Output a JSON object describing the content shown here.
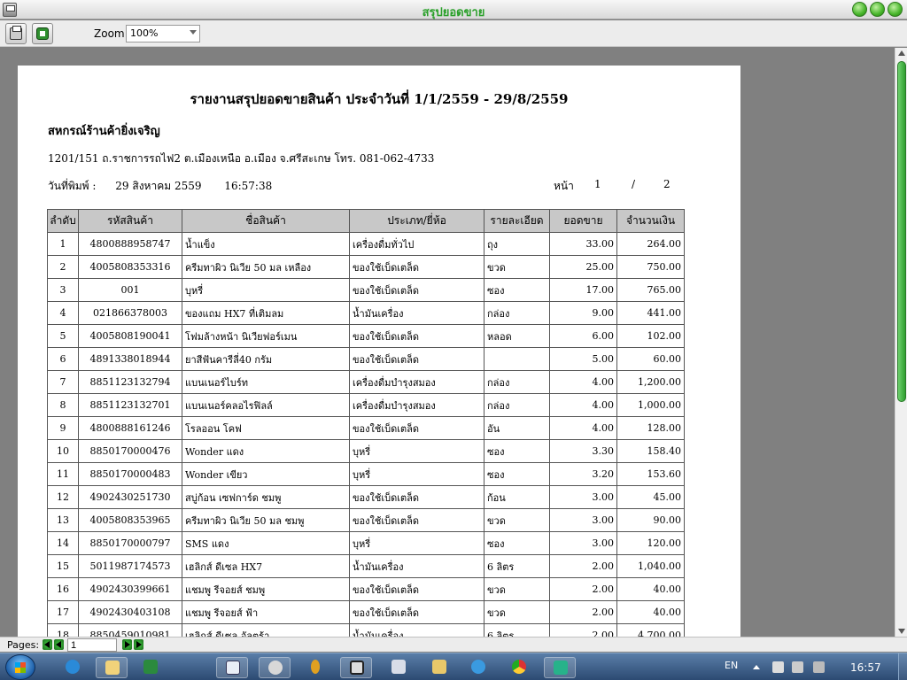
{
  "window": {
    "title": "สรุปยอดขาย"
  },
  "toolbar": {
    "zoom_label": "Zoom",
    "zoom_value": "100%"
  },
  "report": {
    "title": "รายงานสรุปยอดขายสินค้า  ประจำวันที่  1/1/2559  -  29/8/2559",
    "company": "สหกรณ์ร้านค้ายิ่งเจริญ",
    "address": "1201/151 ถ.ราชการรถไฟ2 ต.เมืองเหนือ อ.เมือง จ.ศรีสะเกษ  โทร. 081-062-4733",
    "print_label": "วันที่พิมพ์ :",
    "print_date": "29 สิงหาคม 2559",
    "print_time": "16:57:38",
    "page_label": "หน้า",
    "page_current": "1",
    "page_sep": "/",
    "page_total": "2",
    "headers": [
      "ลำดับ",
      "รหัสสินค้า",
      "ชื่อสินค้า",
      "ประเภท/ยี่ห้อ",
      "รายละเอียด",
      "ยอดขาย",
      "จำนวนเงิน"
    ],
    "rows": [
      [
        "1",
        "4800888958747",
        "น้ำแข็ง",
        "เครื่องดื่มทั่วไป",
        "ถุง",
        "33.00",
        "264.00"
      ],
      [
        "2",
        "4005808353316",
        "ครีมทาผิว นิเวีย 50 มล เหลือง",
        "ของใช้เบ็ดเตล็ด",
        "ขวด",
        "25.00",
        "750.00"
      ],
      [
        "3",
        "001",
        "บุหรี่",
        "ของใช้เบ็ดเตล็ด",
        "ซอง",
        "17.00",
        "765.00"
      ],
      [
        "4",
        "021866378003",
        "ของแถม HX7 ที่เติมลม",
        "น้ำมันเครื่อง",
        "กล่อง",
        "9.00",
        "441.00"
      ],
      [
        "5",
        "4005808190041",
        "โฟมล้างหน้า นิเวียฟอร์เมน",
        "ของใช้เบ็ดเตล็ด",
        "หลอด",
        "6.00",
        "102.00"
      ],
      [
        "6",
        "4891338018944",
        "ยาสีฟันคารีลี่40 กรัม",
        "ของใช้เบ็ดเตล็ด",
        "",
        "5.00",
        "60.00"
      ],
      [
        "7",
        "8851123132794",
        "แบนเนอร์ไบร์ท",
        "เครื่องดื่มบำรุงสมอง",
        "กล่อง",
        "4.00",
        "1,200.00"
      ],
      [
        "8",
        "8851123132701",
        "แบนเนอร์คลอไรฟิลล์",
        "เครื่องดื่มบำรุงสมอง",
        "กล่อง",
        "4.00",
        "1,000.00"
      ],
      [
        "9",
        "4800888161246",
        "โรลออน โคฟ",
        "ของใช้เบ็ดเตล็ด",
        "อัน",
        "4.00",
        "128.00"
      ],
      [
        "10",
        "8850170000476",
        "Wonder แดง",
        "บุหรี่",
        "ซอง",
        "3.30",
        "158.40"
      ],
      [
        "11",
        "8850170000483",
        "Wonder เขียว",
        "บุหรี่",
        "ซอง",
        "3.20",
        "153.60"
      ],
      [
        "12",
        "4902430251730",
        "สบู่ก้อน เซฟการ์ด ชมพู",
        "ของใช้เบ็ดเตล็ด",
        "ก้อน",
        "3.00",
        "45.00"
      ],
      [
        "13",
        "4005808353965",
        "ครีมทาผิว นิเวีย 50 มล ชมพู",
        "ของใช้เบ็ดเตล็ด",
        "ขวด",
        "3.00",
        "90.00"
      ],
      [
        "14",
        "8850170000797",
        "SMS แดง",
        "บุหรี่",
        "ซอง",
        "3.00",
        "120.00"
      ],
      [
        "15",
        "5011987174573",
        "เฮลิกส์ ดีเซล HX7",
        "น้ำมันเครื่อง",
        "6 ลิตร",
        "2.00",
        "1,040.00"
      ],
      [
        "16",
        "4902430399661",
        "แชมพู รีจอยส์ ชมพู",
        "ของใช้เบ็ดเตล็ด",
        "ขวด",
        "2.00",
        "40.00"
      ],
      [
        "17",
        "4902430403108",
        "แชมพู รีจอยส์ ฟ้า",
        "ของใช้เบ็ดเตล็ด",
        "ขวด",
        "2.00",
        "40.00"
      ],
      [
        "18",
        "8850459010981",
        "เฮลิกส์ ดีเซล อัลตร้า",
        "น้ำมันเครื่อง",
        "6 ลิตร",
        "2.00",
        "4,700.00"
      ]
    ]
  },
  "pagesbar": {
    "label": "Pages:",
    "current": "1"
  },
  "taskbar": {
    "apps": [
      "internet-explorer",
      "file-explorer",
      "excel",
      "word",
      "paint",
      "key",
      "camera",
      "notepad",
      "folder",
      "messenger",
      "chrome",
      "report-app"
    ],
    "lang": "EN",
    "time": "16:57"
  }
}
